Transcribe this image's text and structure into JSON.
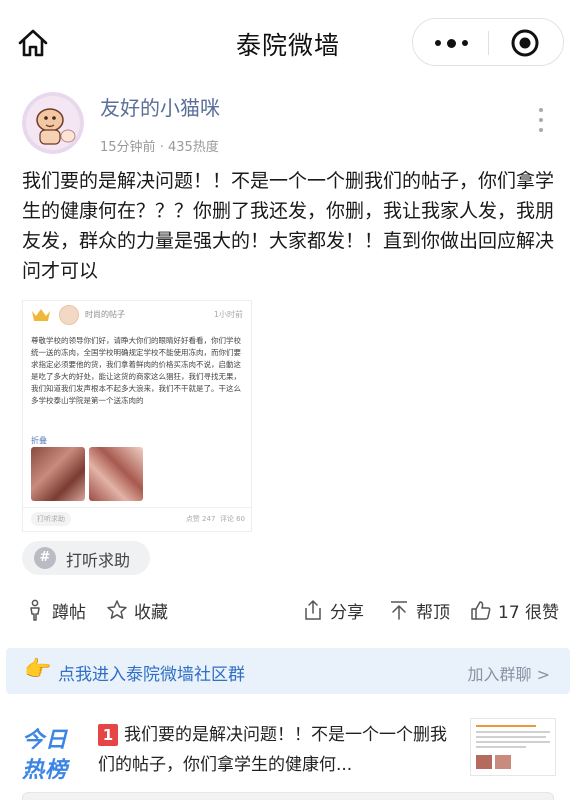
{
  "header": {
    "title": "泰院微墙"
  },
  "post": {
    "author": "友好的小猫咪",
    "time_ago": "15分钟前",
    "heat": "· 435热度",
    "body": "我们要的是解决问题！！不是一个一个删我们的帖子，你们拿学生的健康何在？？？你删了我还发，你删，我让我家人发，我朋友发，群众的力量是强大的！大家都发！！直到你做出回应解决问才可以",
    "embed": {
      "author": "时尚的帖子",
      "time": "1小时前",
      "body": "尊敬学校的领导你们好，请睁大你们的眼睛好好看看，你们学校统一送的冻肉，全国学校明确规定学校不能使用冻肉，而你们要求指定必须要他的货，我们拿着鲜肉的价格买冻肉不说，启動这是吃了多大的好处，能让这货的商家这么猖狂，我们寻找无果，我们知道我们发声根本不起多大浪来，我们不干就是了。干这么多学校泰山学院是第一个送冻肉的",
      "collapse": "折叠",
      "tag": "打听求助",
      "views": "点赞 247",
      "comments": "评论 60"
    },
    "tag": "打听求助"
  },
  "actions": {
    "step": "蹲帖",
    "favorite": "收藏",
    "share": "分享",
    "pin": "帮顶",
    "like": "17 很赞"
  },
  "banner": {
    "text": "点我进入泰院微墙社区群",
    "join": "加入群聊 >"
  },
  "hot": {
    "logo_line1": "今日",
    "logo_line2": "热榜",
    "rank": "1",
    "title": "我们要的是解决问题！！不是一个一个删我们的帖子，你们拿学生的健康何..."
  },
  "icons": {
    "home": "home-icon",
    "more": "more-dots-icon",
    "close": "mini-program-close-icon",
    "menu": "vertical-dots-icon",
    "step": "figure-icon",
    "favorite": "star-icon",
    "share": "share-icon",
    "pin": "up-arrow-icon",
    "like": "thumbs-up-icon",
    "hand": "pointing-hand-icon",
    "tag": "hash-icon",
    "crown": "crown-icon"
  },
  "colors": {
    "link_blue": "#5a6f99",
    "banner_bg": "#e9f1fb",
    "banner_text": "#2f6fc4",
    "hot_blue": "#3b86e5",
    "rank_red": "#e64545"
  }
}
